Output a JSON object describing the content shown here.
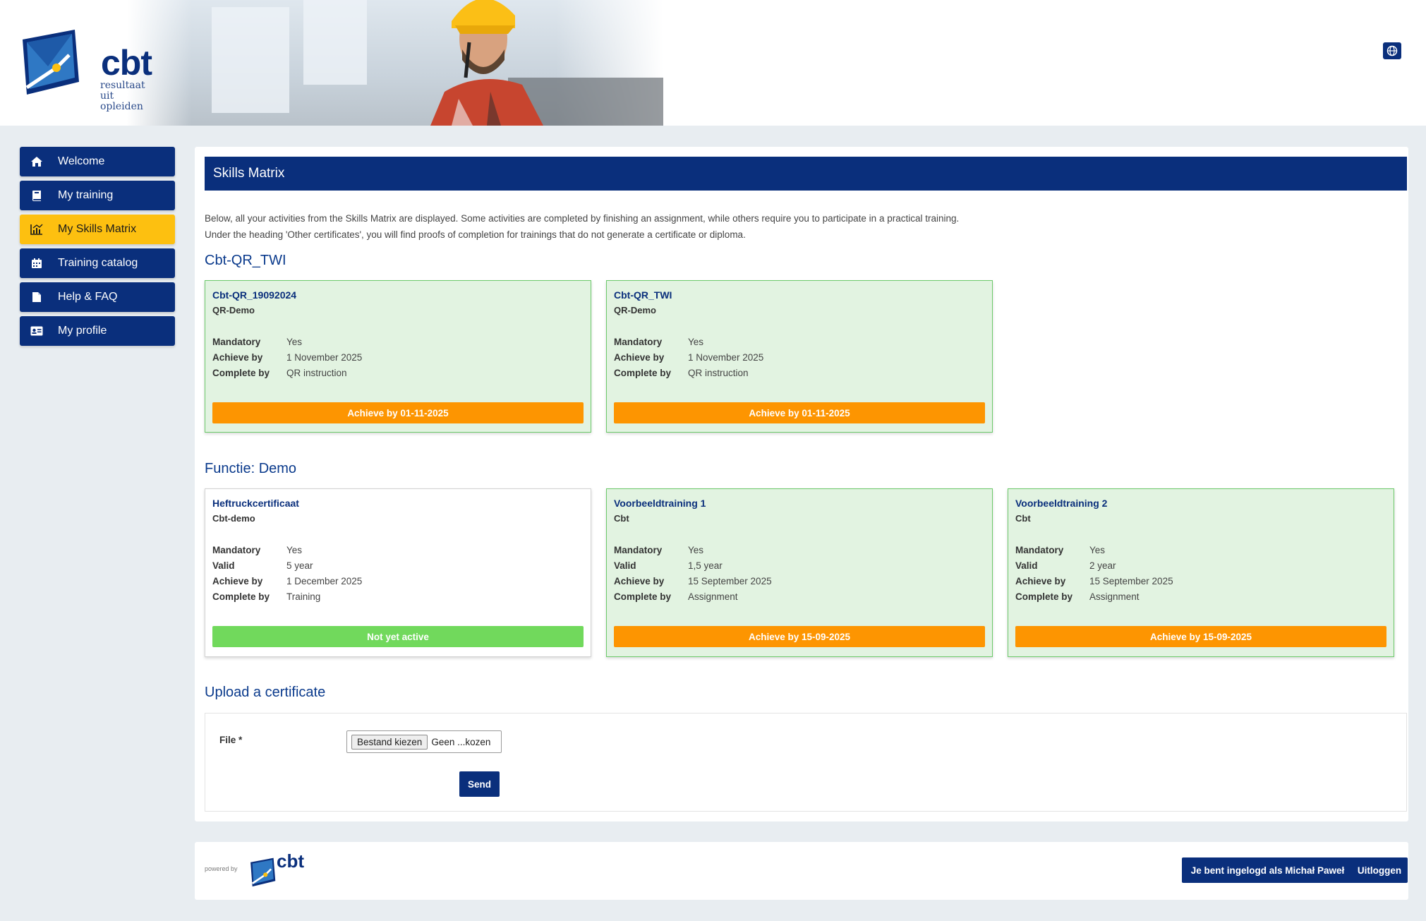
{
  "header": {
    "logo_text": "cbt",
    "logo_sub_line1": "resultaat uit",
    "logo_sub_line2": "opleiden",
    "language_icon": "globe-icon"
  },
  "sidebar": {
    "items": [
      {
        "label": "Welcome",
        "icon": "home-icon"
      },
      {
        "label": "My training",
        "icon": "book-icon"
      },
      {
        "label": "My Skills Matrix",
        "icon": "chart-icon",
        "active": true
      },
      {
        "label": "Training catalog",
        "icon": "calendar-icon"
      },
      {
        "label": "Help & FAQ",
        "icon": "document-icon"
      },
      {
        "label": "My profile",
        "icon": "id-card-icon"
      }
    ]
  },
  "main": {
    "title": "Skills Matrix",
    "intro_line1": "Below, all your activities from the Skills Matrix are displayed. Some activities are completed by finishing an assignment, while others require you to participate in a practical training.",
    "intro_line2": "Under the heading 'Other certificates', you will find proofs of completion for trainings that do not generate a certificate or diploma.",
    "sections": [
      {
        "title": "Cbt-QR_TWI",
        "cards": [
          {
            "title": "Cbt-QR_19092024",
            "subtitle": "QR-Demo",
            "rows": [
              [
                "Mandatory",
                "Yes"
              ],
              [
                "Achieve by",
                "1 November 2025"
              ],
              [
                "Complete by",
                "QR instruction"
              ]
            ],
            "button": "Achieve by 01-11-2025"
          },
          {
            "title": "Cbt-QR_TWI",
            "subtitle": "QR-Demo",
            "rows": [
              [
                "Mandatory",
                "Yes"
              ],
              [
                "Achieve by",
                "1 November 2025"
              ],
              [
                "Complete by",
                "QR instruction"
              ]
            ],
            "button": "Achieve by 01-11-2025"
          }
        ]
      },
      {
        "title": "Functie: Demo",
        "cards": [
          {
            "title": "Heftruckcertificaat",
            "subtitle": "Cbt-demo",
            "rows": [
              [
                "Mandatory",
                "Yes"
              ],
              [
                "Valid",
                "5 year"
              ],
              [
                "Achieve by",
                "1 December 2025"
              ],
              [
                "Complete by",
                "Training"
              ]
            ],
            "button": "Not yet active"
          },
          {
            "title": "Voorbeeldtraining 1",
            "subtitle": "Cbt",
            "rows": [
              [
                "Mandatory",
                "Yes"
              ],
              [
                "Valid",
                "1,5 year"
              ],
              [
                "Achieve by",
                "15 September 2025"
              ],
              [
                "Complete by",
                "Assignment"
              ]
            ],
            "button": "Achieve by 15-09-2025"
          },
          {
            "title": "Voorbeeldtraining 2",
            "subtitle": "Cbt",
            "rows": [
              [
                "Mandatory",
                "Yes"
              ],
              [
                "Valid",
                "2 year"
              ],
              [
                "Achieve by",
                "15 September 2025"
              ],
              [
                "Complete by",
                "Assignment"
              ]
            ],
            "button": "Achieve by 15-09-2025"
          }
        ]
      }
    ],
    "upload": {
      "title": "Upload a certificate",
      "file_label": "File *",
      "choose_button": "Bestand kiezen",
      "file_value": "Geen ...kozen",
      "send": "Send"
    }
  },
  "footer": {
    "powered_by": "powered by",
    "logo_text": "cbt",
    "logged_in": "Je bent ingelogd als Michał Paweł",
    "logout": "Uitloggen"
  },
  "colors": {
    "brand_blue": "#0a2f7c",
    "active_yellow": "#fdc010",
    "warning_orange": "#fd9501",
    "success_green": "#71d95c",
    "card_green_bg": "#e2f3e1"
  }
}
